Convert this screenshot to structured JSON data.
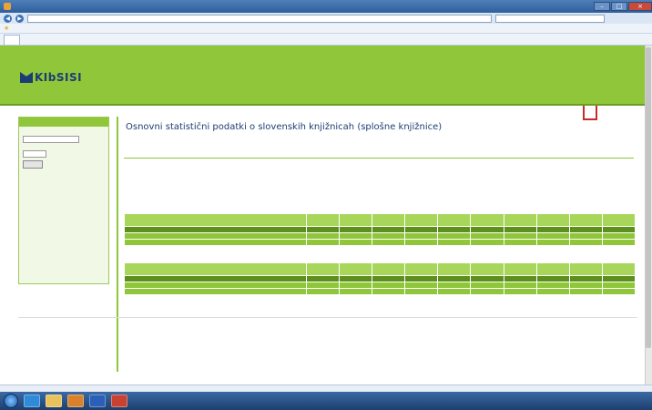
{
  "browser": {
    "title": "",
    "url": "",
    "search_placeholder": "",
    "tab_label": "",
    "status_text": "",
    "status_zone": ""
  },
  "site": {
    "logo_text": "KIbSISI",
    "nav_tabs": []
  },
  "sidebar": {
    "heading": "",
    "year_value": "",
    "region_value": "",
    "submit_label": "",
    "links": []
  },
  "main": {
    "title": "Osnovni statistični podatki o slovenskih knjižnicah (splošne knjižnice)",
    "section": "",
    "table1": {
      "header_first": "",
      "rows": []
    },
    "table2": {
      "header_first": "",
      "rows": []
    },
    "link_bottom_1": "",
    "link_bottom_2": ""
  },
  "footer": {
    "text": ""
  },
  "taskbar": {
    "time": "",
    "date": ""
  }
}
